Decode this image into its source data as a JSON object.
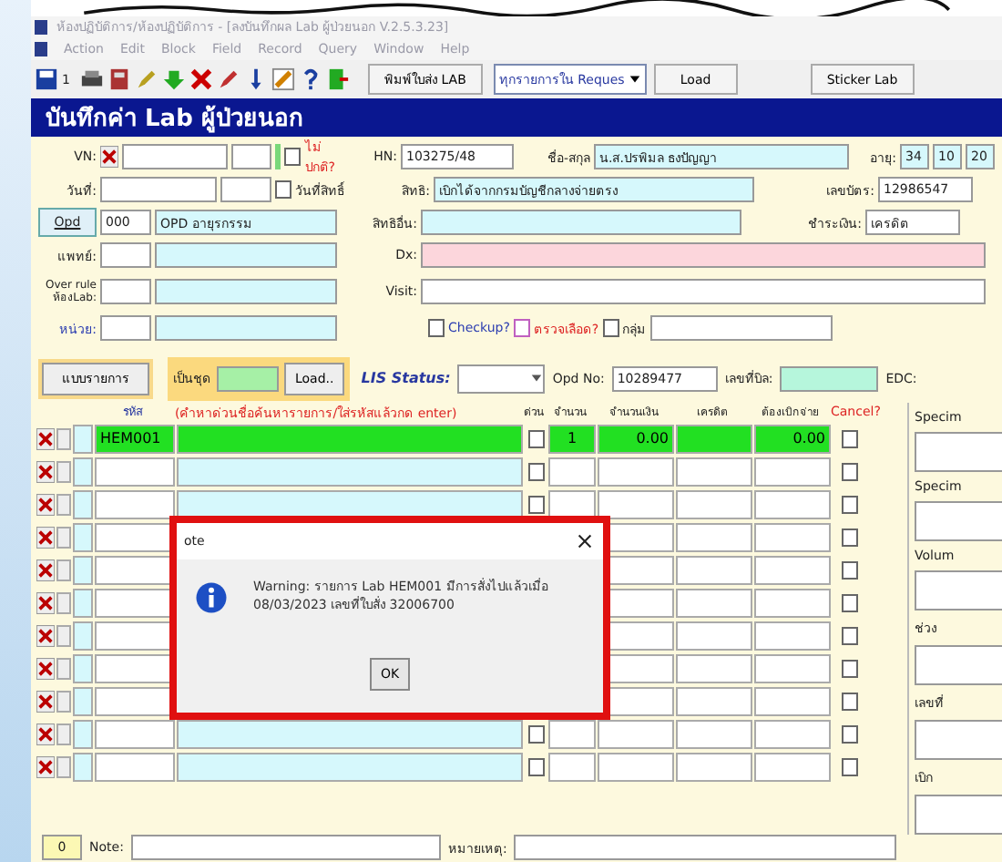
{
  "window": {
    "title": "ห้องปฏิบัติการ/ห้องปฏิบัติการ - [ลงบันทึกผล Lab ผู้ป่วยนอก V.2.5.3.23]"
  },
  "menu": [
    "Action",
    "Edit",
    "Block",
    "Field",
    "Record",
    "Query",
    "Window",
    "Help"
  ],
  "toolbar": {
    "page_number": "1",
    "print_button": "พิมพ์ใบส่ง LAB",
    "request_dropdown": "ทุกรายการใน Reques",
    "load_button": "Load",
    "sticker_button": "Sticker Lab"
  },
  "header": "บันทึกค่า Lab ผู้ป่วยนอก",
  "form": {
    "vn_label": "VN:",
    "abnormal_label": "ไม่ปกติ?",
    "hn_label": "HN:",
    "hn": "103275/48",
    "name_label": "ชื่อ-สกุล",
    "name": "น.ส.ปรพิมล ธงปัญญา",
    "age_label": "อายุ:",
    "age": [
      "34",
      "10",
      "20"
    ],
    "date_label": "วันที่:",
    "right_date_label": "วันที่สิทธิ์",
    "rights_label": "สิทธิ:",
    "rights": "เบิกได้จากกรมบัญชีกลางจ่ายตรง",
    "card_label": "เลขบัตร:",
    "card": "12986547",
    "opd_button": "Opd",
    "opd_code": "000",
    "opd_name": "OPD อายุรกรรม",
    "other_rights_label": "สิทธิอื่น:",
    "payment_label": "ชำระเงิน:",
    "payment": "เครดิต",
    "doctor_label": "แพทย์:",
    "dx_label": "Dx:",
    "override_label": "Over rule ห้องLab:",
    "visit_label": "Visit:",
    "unit_label": "หน่วย:",
    "checkup_label": "Checkup?",
    "blood_label": "ตรวจเลือด?",
    "group_label": "กลุ่ม",
    "abnormal_checked": false,
    "right_date_checked": false,
    "checkup_checked": false,
    "blood_checked": false,
    "group_checked": false
  },
  "actions": {
    "list_button": "แบบรายการ",
    "set_label": "เป็นชุด",
    "load_button": "Load..",
    "lis_label": "LIS Status:",
    "opd_no_label": "Opd No:",
    "opd_no": "10289477",
    "bill_label": "เลขที่บิล:",
    "edc_label": "EDC:"
  },
  "grid": {
    "columns": [
      "รหัส",
      "(คำหาด่วนชื่อค้นหารายการ/ใส่รหัสแล้วกด enter)",
      "ด่วน",
      "จำนวน",
      "จำนวนเงิน",
      "เครดิต",
      "ต้องเบิกจ่าย",
      "Cancel?"
    ],
    "rows": [
      {
        "selected": true,
        "code": "HEM001",
        "qty": "1",
        "amount": "0.00",
        "pay": "0.00"
      },
      {
        "selected": false
      },
      {
        "selected": false
      },
      {
        "selected": false
      },
      {
        "selected": false
      },
      {
        "selected": false
      },
      {
        "selected": false
      },
      {
        "selected": false
      },
      {
        "selected": false
      },
      {
        "selected": false
      },
      {
        "selected": false
      }
    ]
  },
  "side_panel": [
    "Specim",
    "Specim",
    "Volum",
    "ช่วง",
    "เลขที่",
    "เบิก"
  ],
  "footer": {
    "count": "0",
    "note_label": "Note:",
    "remark_label": "หมายเหตุ:"
  },
  "dialog": {
    "title": "ote",
    "message": "Warning: รายการ Lab HEM001 มีการสั่งไปแล้วเมื่อ 08/03/2023 เลขที่ใบสั่ง 32006700",
    "ok_button": "OK"
  }
}
